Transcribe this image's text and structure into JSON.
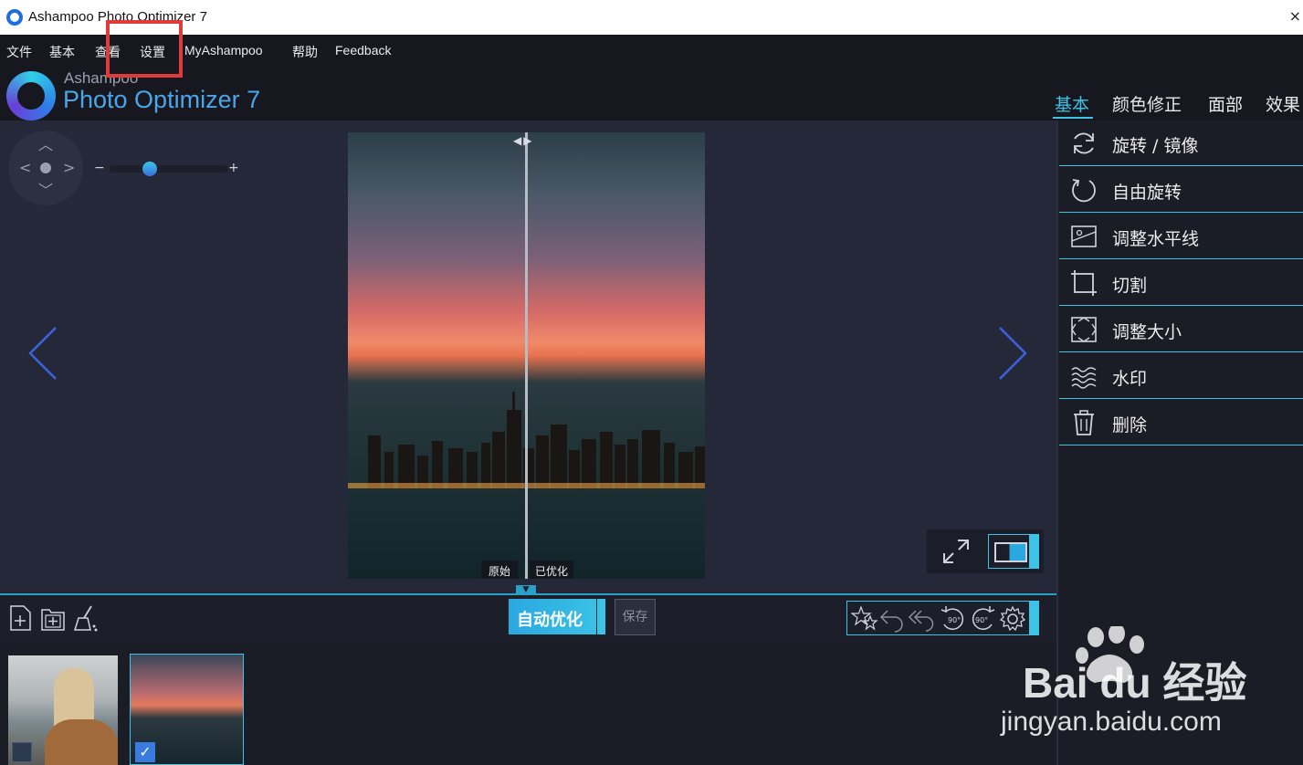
{
  "window": {
    "title": "Ashampoo Photo Optimizer 7",
    "close_glyph": "×"
  },
  "menu": {
    "items": [
      "文件",
      "基本",
      "查看",
      "设置",
      "MyAshampoo",
      "帮助",
      "Feedback"
    ]
  },
  "brand": {
    "top": "Ashampoo",
    "main": "Photo Optimizer 7"
  },
  "tabs": [
    "基本",
    "颜色修正",
    "面部",
    "效果"
  ],
  "zoom": {
    "minus": "−",
    "plus": "+"
  },
  "compare": {
    "original": "原始",
    "optimized": "已优化"
  },
  "toolbar": {
    "auto_optimize": "自动优化",
    "save": "保存"
  },
  "tools": [
    {
      "label": "旋转 / 镜像",
      "icon": "rotate-refresh-icon"
    },
    {
      "label": "自由旋转",
      "icon": "free-rotate-icon"
    },
    {
      "label": "调整水平线",
      "icon": "horizon-icon"
    },
    {
      "label": "切割",
      "icon": "crop-icon"
    },
    {
      "label": "调整大小",
      "icon": "resize-icon"
    },
    {
      "label": "水印",
      "icon": "watermark-icon"
    },
    {
      "label": "删除",
      "icon": "trash-icon"
    }
  ],
  "rotate_labels": {
    "left": "90°",
    "right": "90°"
  },
  "baidu_watermark": {
    "brand": "Bai du 经验",
    "url": "jingyan.baidu.com"
  },
  "colors": {
    "accent": "#3cc3e6",
    "highlight_box": "#e03b3b",
    "background": "#1f2230"
  }
}
